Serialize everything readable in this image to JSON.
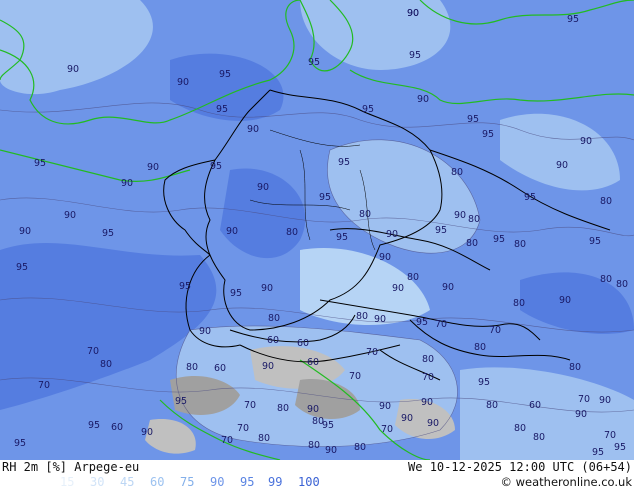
{
  "map": {
    "colors": {
      "background": "#6e95e8",
      "dark_blue": "#557de0",
      "light_blue": "#9ec0f0",
      "lighter": "#b6d4f5",
      "pale": "#cfe4f8",
      "gray_low": "#a0a0a0",
      "gray_mid": "#c0c0c0",
      "coast": "#22bb22",
      "border": "#000000",
      "contour": "#4a4a80"
    },
    "contour_labels": [
      "90",
      "95",
      "90",
      "95",
      "90",
      "95",
      "95",
      "95",
      "90",
      "95",
      "90",
      "95",
      "95",
      "90",
      "95",
      "90",
      "90",
      "95",
      "95",
      "90",
      "95",
      "80",
      "90",
      "80",
      "95",
      "90",
      "80",
      "90",
      "95",
      "90",
      "80",
      "80",
      "95",
      "90",
      "95",
      "80",
      "95",
      "80",
      "90",
      "95",
      "90",
      "80",
      "90",
      "95",
      "80",
      "80",
      "95",
      "90",
      "95",
      "90",
      "80",
      "90",
      "90",
      "80",
      "80",
      "70",
      "95",
      "90",
      "70",
      "80",
      "60",
      "60",
      "70",
      "80",
      "60",
      "90",
      "80",
      "70",
      "60",
      "80",
      "70",
      "95",
      "70",
      "80",
      "90",
      "70",
      "80",
      "70",
      "90",
      "95",
      "80",
      "60",
      "70",
      "90",
      "80",
      "60",
      "90",
      "95",
      "70",
      "80",
      "70",
      "70",
      "80",
      "90",
      "90",
      "95",
      "80",
      "95",
      "90",
      "80",
      "90",
      "95",
      "95",
      "70",
      "90",
      "80",
      "90"
    ]
  },
  "header": {
    "title_left": "RH 2m [%] Arpege-eu",
    "title_right": "We 10-12-2025 12:00 UTC (06+54)"
  },
  "legend": {
    "values": [
      "15",
      "30",
      "45",
      "60",
      "75",
      "90",
      "95",
      "99",
      "100"
    ],
    "colors": [
      "#e6f0fa",
      "#d2e4f8",
      "#bcd6f4",
      "#9cc2f0",
      "#84b0ea",
      "#6e95e8",
      "#5a84e2",
      "#4a72dc",
      "#3a62d4"
    ]
  },
  "credit": "© weatheronline.co.uk"
}
